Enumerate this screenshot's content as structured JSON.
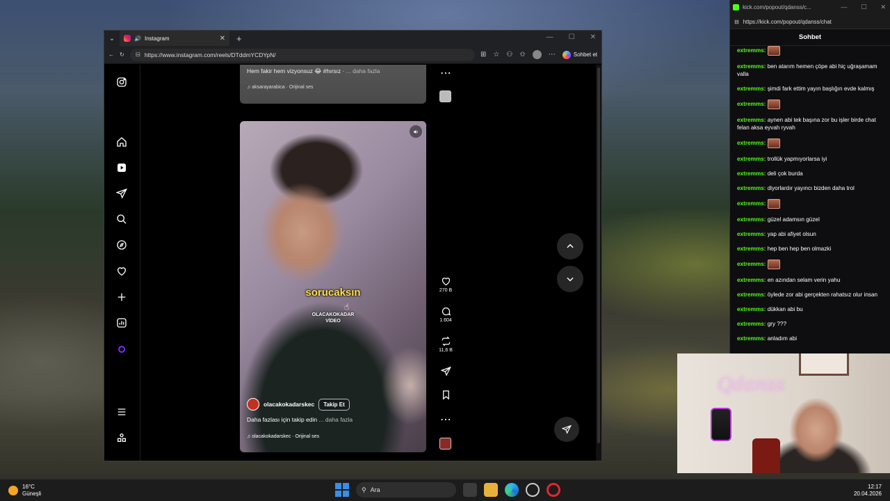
{
  "browser": {
    "tab_title": "Instagram",
    "url": "https://www.instagram.com/reels/DTddmYCDYpN/",
    "copilot_label": "Sohbet et"
  },
  "instagram": {
    "prev_reel": {
      "caption": "Hem fakir hem vizyonsuz 😂 #hırsız · ",
      "more": "... daha fazla",
      "audio": "aksarayarabica · Orijinal ses"
    },
    "reel": {
      "subtitle_big": "sorucaksın",
      "subtitle_small": "OLACAKOKADAR\nVİDEO",
      "username": "olacakokadarskec",
      "follow_label": "Takip Et",
      "caption": "Daha fazlası için takip edin ",
      "more": "... daha fazla",
      "audio": "olacakokadarskec · Orijinal ses"
    },
    "actions": {
      "likes": "270 B",
      "comments": "1.604",
      "reposts": "11,6 B"
    }
  },
  "chat": {
    "window_url_title": "kick.com/popout/qdanss/c...",
    "url": "https://kick.com/popout/qdanss/chat",
    "header": "Sohbet",
    "messages": [
      {
        "user": "extremms:",
        "text": ""
      },
      {
        "user": "extremms:",
        "text": "ben atarım hemen çöpe abi hiç uğraşamam valla"
      },
      {
        "user": "extremms:",
        "text": "şimdi fark ettim yayın başlığın evde kalmış"
      },
      {
        "user": "extremms:",
        "text": ""
      },
      {
        "user": "extremms:",
        "text": "aynen abi tek başına zor bu işler birde chat felan aksa eyvah ryvah"
      },
      {
        "user": "extremms:",
        "text": ""
      },
      {
        "user": "extremms:",
        "text": "trollük yapmıyorlarsa iyi"
      },
      {
        "user": "extremms:",
        "text": "deli çok burda"
      },
      {
        "user": "extremms:",
        "text": "diyorlardır yayıncı bizden daha trol"
      },
      {
        "user": "extremms:",
        "text": ""
      },
      {
        "user": "extremms:",
        "text": "güzel adamsın güzel"
      },
      {
        "user": "extremms:",
        "text": "yap abi afiyet olsun"
      },
      {
        "user": "extremms:",
        "text": "hep ben hep ben olmazki"
      },
      {
        "user": "extremms:",
        "text": ""
      },
      {
        "user": "extremms:",
        "text": "en azından selam verin yahu"
      },
      {
        "user": "extremms:",
        "text": "öylede zor abi gerçekten rahatsız olur insan"
      },
      {
        "user": "extremms:",
        "text": "dükkan abi bu"
      },
      {
        "user": "extremms:",
        "text": "gry ???"
      },
      {
        "user": "extremms:",
        "text": "anladım abi"
      }
    ]
  },
  "webcam": {
    "neon_text": "Qdanss"
  },
  "taskbar": {
    "temp": "16°C",
    "weather": "Güneşli",
    "search_placeholder": "Ara",
    "time": "12:17",
    "date": "20.04.2026"
  },
  "colors": {
    "kick_green": "#53fc18",
    "subtitle_yellow": "#ffe14d",
    "taskbar_bg": "#1c1c1c"
  }
}
